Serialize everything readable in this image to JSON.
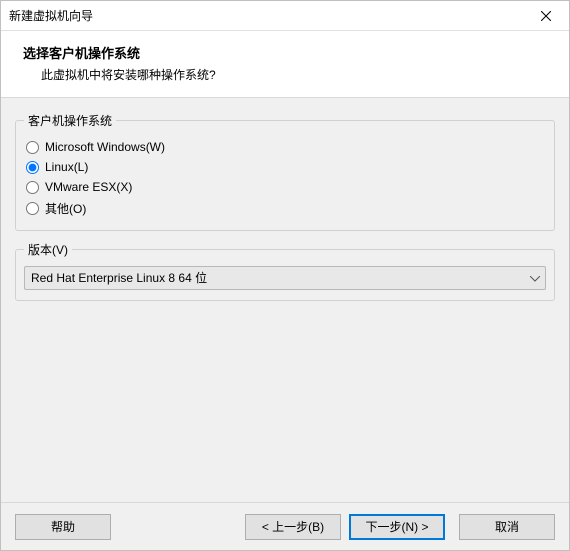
{
  "titlebar": {
    "title": "新建虚拟机向导"
  },
  "header": {
    "title": "选择客户机操作系统",
    "subtitle": "此虚拟机中将安装哪种操作系统?"
  },
  "os_group": {
    "legend": "客户机操作系统",
    "options": [
      {
        "label": "Microsoft Windows(W)",
        "value": "windows"
      },
      {
        "label": "Linux(L)",
        "value": "linux"
      },
      {
        "label": "VMware ESX(X)",
        "value": "esx"
      },
      {
        "label": "其他(O)",
        "value": "other"
      }
    ],
    "selected": "linux"
  },
  "version_group": {
    "legend": "版本(V)",
    "selected": "Red Hat Enterprise Linux 8 64 位"
  },
  "buttons": {
    "help": "帮助",
    "back": "< 上一步(B)",
    "next": "下一步(N) >",
    "cancel": "取消"
  }
}
